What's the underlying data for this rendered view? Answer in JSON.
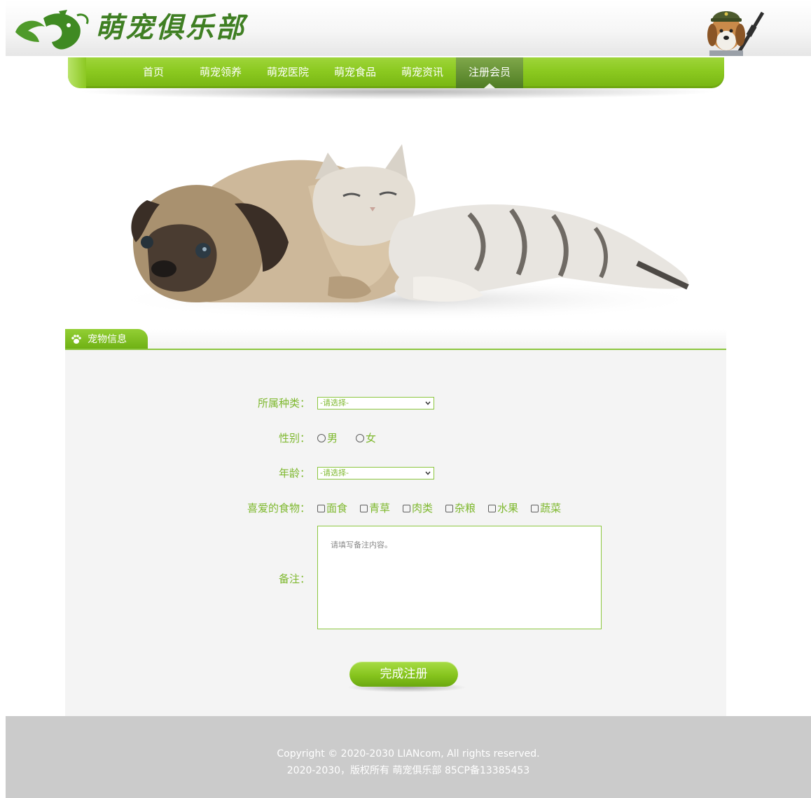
{
  "header": {
    "brand_name": "萌宠俱乐部"
  },
  "nav": {
    "items": [
      {
        "label": "首页"
      },
      {
        "label": "萌宠领养"
      },
      {
        "label": "萌宠医院"
      },
      {
        "label": "萌宠食品"
      },
      {
        "label": "萌宠资讯"
      },
      {
        "label": "注册会员",
        "active": true
      }
    ]
  },
  "panel": {
    "tab_title": "宠物信息"
  },
  "form": {
    "species": {
      "label": "所属种类：",
      "selected": "-请选择-"
    },
    "gender": {
      "label": "性别：",
      "options": [
        "男",
        "女"
      ]
    },
    "age": {
      "label": "年龄：",
      "selected": "-请选择-"
    },
    "foods": {
      "label": "喜爱的食物：",
      "options": [
        "面食",
        "青草",
        "肉类",
        "杂粮",
        "水果",
        "蔬菜"
      ]
    },
    "notes": {
      "label": "备注：",
      "placeholder": "请填写备注内容。"
    },
    "submit_label": "完成注册"
  },
  "footer": {
    "line1": "Copyright © 2020-2030 LIANcom, All rights reserved.",
    "line2": "2020-2030，版权所有 萌宠俱乐部 85CP备13385453"
  },
  "colors": {
    "accent_green": "#8cc63f",
    "label_green": "#7eb82e",
    "brand_green": "#3f7f23",
    "footer_gray": "#cbcbcb"
  }
}
